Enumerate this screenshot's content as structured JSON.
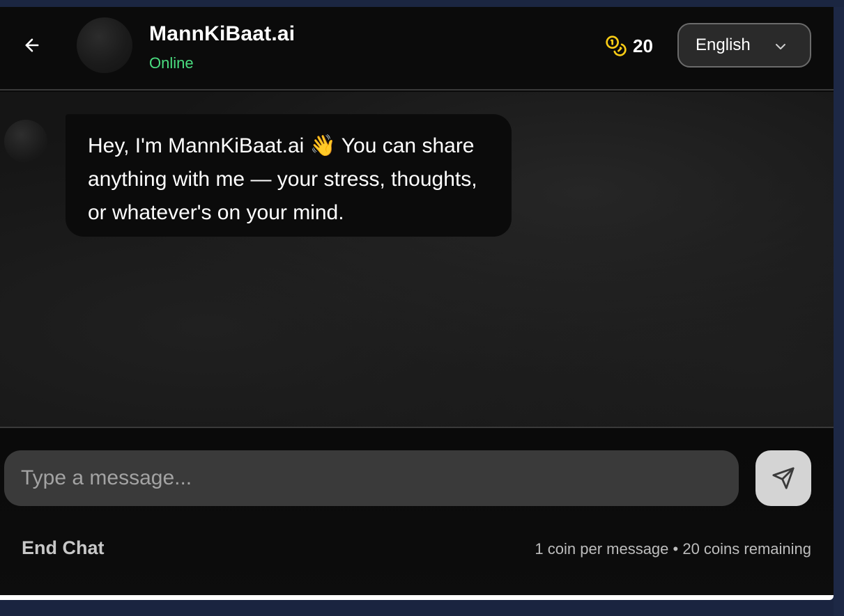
{
  "header": {
    "title": "MannKiBaat.ai",
    "status": "Online",
    "coin_count": "20",
    "language": "English"
  },
  "messages": [
    {
      "sender": "bot",
      "text": "Hey, I'm MannKiBaat.ai 👋 You can share anything with me — your stress, thoughts, or whatever's on your mind."
    }
  ],
  "composer": {
    "placeholder": "Type a message...",
    "value": ""
  },
  "footer": {
    "end_chat_label": "End Chat",
    "pricing_text": "1 coin per message • 20 coins remaining"
  },
  "colors": {
    "accent_status": "#4ade80",
    "coin_icon": "#facc15",
    "send_button_bg": "#d4d4d4"
  },
  "icons": {
    "back": "arrow-left-icon",
    "coins": "coins-icon",
    "chevron": "chevron-down-icon",
    "send": "send-icon"
  }
}
